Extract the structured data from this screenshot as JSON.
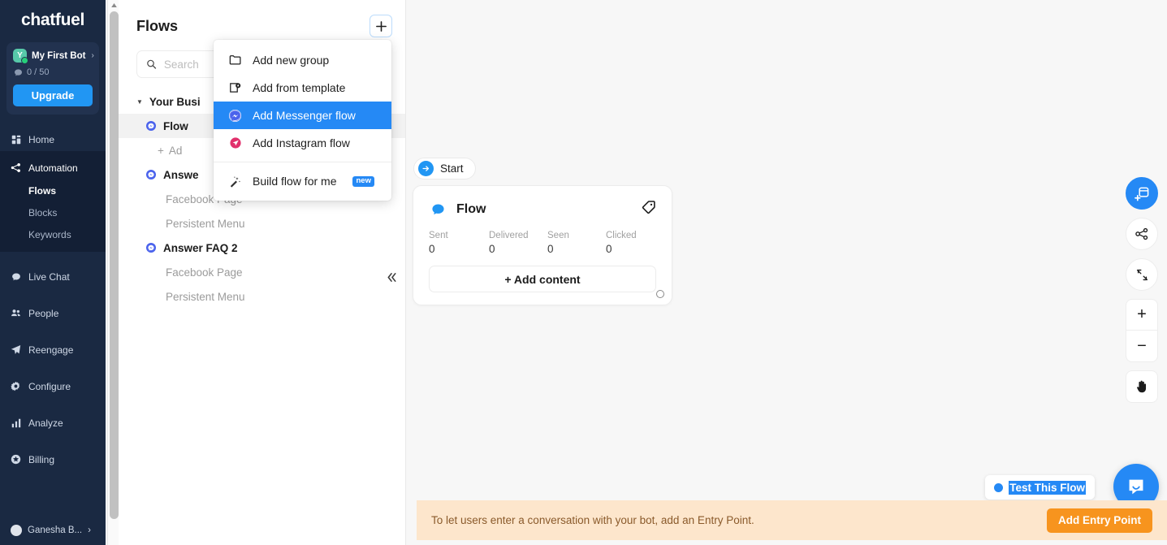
{
  "sidebar": {
    "brand": "chatfuel",
    "bot": {
      "avatar_letter": "Y",
      "name": "My First Bot",
      "chevron": "›",
      "quota": "0 / 50",
      "upgrade_label": "Upgrade"
    },
    "nav": [
      {
        "label": "Home",
        "icon": "home-icon"
      },
      {
        "label": "Automation",
        "icon": "automation-icon"
      },
      {
        "label": "Live Chat",
        "icon": "live-chat-icon"
      },
      {
        "label": "People",
        "icon": "people-icon"
      },
      {
        "label": "Reengage",
        "icon": "reengage-icon"
      },
      {
        "label": "Configure",
        "icon": "configure-icon"
      },
      {
        "label": "Analyze",
        "icon": "analyze-icon"
      },
      {
        "label": "Billing",
        "icon": "billing-icon"
      }
    ],
    "automation_subitems": [
      {
        "label": "Flows",
        "selected": true
      },
      {
        "label": "Blocks",
        "selected": false
      },
      {
        "label": "Keywords",
        "selected": false
      }
    ],
    "account": {
      "name": "Ganesha B...",
      "chevron": "›"
    }
  },
  "flows_panel": {
    "title": "Flows",
    "add_button": "+",
    "search_placeholder": "Search",
    "search_value": "",
    "collapse_icon": "«",
    "tree": [
      {
        "type": "group",
        "label": "Your Busi",
        "caret": "▼"
      },
      {
        "type": "flow",
        "label": "Flow",
        "selected": true
      },
      {
        "type": "add",
        "label": "Ad",
        "plus": "+"
      },
      {
        "type": "flow",
        "label": "Answe",
        "selected": false
      },
      {
        "type": "leaf",
        "label": "Facebook Page"
      },
      {
        "type": "leaf",
        "label": "Persistent Menu"
      },
      {
        "type": "flow",
        "label": "Answer FAQ 2",
        "selected": false
      },
      {
        "type": "leaf",
        "label": "Facebook Page"
      },
      {
        "type": "leaf",
        "label": "Persistent Menu"
      }
    ]
  },
  "menu": {
    "items": [
      {
        "label": "Add new group",
        "icon": "folder-icon",
        "highlighted": false,
        "badge": ""
      },
      {
        "label": "Add from template",
        "icon": "template-icon",
        "highlighted": false,
        "badge": ""
      },
      {
        "label": "Add Messenger flow",
        "icon": "messenger-icon",
        "highlighted": true,
        "badge": ""
      },
      {
        "label": "Add Instagram flow",
        "icon": "instagram-dm-icon",
        "highlighted": false,
        "badge": ""
      },
      {
        "label": "Build flow for me",
        "icon": "magic-wand-icon",
        "highlighted": false,
        "badge": "new"
      }
    ]
  },
  "canvas": {
    "start_label": "Start",
    "card": {
      "title": "Flow",
      "tag_icon": "tag-icon",
      "stats": [
        {
          "label": "Sent",
          "value": "0"
        },
        {
          "label": "Delivered",
          "value": "0"
        },
        {
          "label": "Seen",
          "value": "0"
        },
        {
          "label": "Clicked",
          "value": "0"
        }
      ],
      "add_content_label": "+ Add content"
    },
    "tools": [
      {
        "name": "add-block-button",
        "icon": "add-block-icon"
      },
      {
        "name": "tree-layout-button",
        "icon": "share-nodes-icon"
      },
      {
        "name": "fit-screen-button",
        "icon": "fit-screen-icon"
      }
    ],
    "zoom_in": "+",
    "zoom_out": "−",
    "pan_icon": "hand-icon",
    "test_flow_label": "Test This Flow"
  },
  "entry_banner": {
    "text": "To let users enter a conversation with your bot, add an Entry Point.",
    "button_label": "Add Entry Point"
  },
  "colors": {
    "sidebar_bg": "#1a2942",
    "sidebar_sub_bg": "#131f35",
    "accent_blue": "#2589f5",
    "messenger_blue": "#4b63ec",
    "instagram_pink": "#e1306c",
    "banner_bg": "#fde6cc",
    "banner_button": "#f7941e",
    "canvas_bg": "#f7f7f7"
  }
}
